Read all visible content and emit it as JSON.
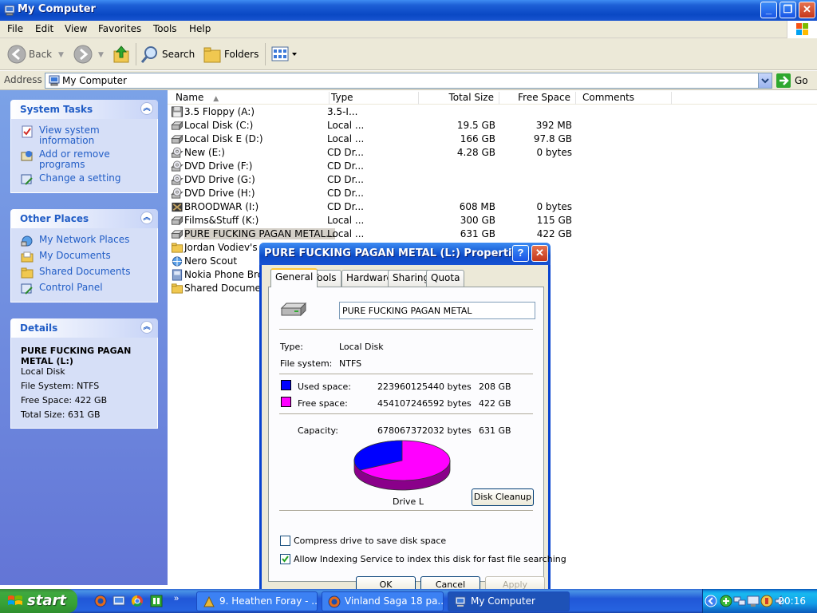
{
  "window": {
    "title": "My Computer",
    "controls": {
      "minimize": "_",
      "maximize": "❐",
      "close": "✕"
    }
  },
  "menu": [
    "File",
    "Edit",
    "View",
    "Favorites",
    "Tools",
    "Help"
  ],
  "toolbar": {
    "back": "Back",
    "search": "Search",
    "folders": "Folders"
  },
  "address": {
    "label": "Address",
    "value": "My Computer",
    "go": "Go"
  },
  "sidebar": {
    "system_tasks": {
      "title": "System Tasks",
      "items": [
        "View system information",
        "Add or remove programs",
        "Change a setting"
      ]
    },
    "other_places": {
      "title": "Other Places",
      "items": [
        "My Network Places",
        "My Documents",
        "Shared Documents",
        "Control Panel"
      ]
    },
    "details": {
      "title": "Details",
      "name": "PURE FUCKING PAGAN METAL (L:)",
      "type": "Local Disk",
      "file_system": "File System: NTFS",
      "free_space": "Free Space: 422 GB",
      "total_size": "Total Size: 631 GB"
    }
  },
  "columns": {
    "name": "Name",
    "type": "Type",
    "total": "Total Size",
    "free": "Free Space",
    "comments": "Comments"
  },
  "files": [
    {
      "name": "3.5 Floppy (A:)",
      "type": "3.5-I...",
      "total": "",
      "free": "",
      "icon": "floppy-icon"
    },
    {
      "name": "Local Disk (C:)",
      "type": "Local ...",
      "total": "19.5 GB",
      "free": "392 MB",
      "icon": "hard-disk-icon"
    },
    {
      "name": "Local Disk E (D:)",
      "type": "Local ...",
      "total": "166 GB",
      "free": "97.8 GB",
      "icon": "hard-disk-icon"
    },
    {
      "name": "New (E:)",
      "type": "CD Dr...",
      "total": "4.28 GB",
      "free": "0 bytes",
      "icon": "cd-drive-icon"
    },
    {
      "name": "DVD Drive (F:)",
      "type": "CD Dr...",
      "total": "",
      "free": "",
      "icon": "cd-drive-icon"
    },
    {
      "name": "DVD Drive (G:)",
      "type": "CD Dr...",
      "total": "",
      "free": "",
      "icon": "cd-drive-icon"
    },
    {
      "name": "DVD Drive (H:)",
      "type": "CD Dr...",
      "total": "",
      "free": "",
      "icon": "cd-drive-icon"
    },
    {
      "name": "BROODWAR (I:)",
      "type": "CD Dr...",
      "total": "608 MB",
      "free": "0 bytes",
      "icon": "game-disc-icon"
    },
    {
      "name": "Films&Stuff (K:)",
      "type": "Local ...",
      "total": "300 GB",
      "free": "115 GB",
      "icon": "hard-disk-icon"
    },
    {
      "name": "PURE FUCKING PAGAN METAL...",
      "type": "Local ...",
      "total": "631 GB",
      "free": "422 GB",
      "icon": "hard-disk-icon",
      "selected": true
    },
    {
      "name": "Jordan Vodiev's",
      "type": "",
      "total": "",
      "free": "",
      "icon": "folder-icon"
    },
    {
      "name": "Nero Scout",
      "type": "",
      "total": "",
      "free": "",
      "icon": "network-globe-icon"
    },
    {
      "name": "Nokia Phone Brow",
      "type": "",
      "total": "",
      "free": "",
      "icon": "phone-browser-icon"
    },
    {
      "name": "Shared Documen",
      "type": "",
      "total": "",
      "free": "",
      "icon": "folder-icon"
    }
  ],
  "dialog": {
    "title": "PURE FUCKING PAGAN METAL (L:) Properties",
    "tabs": [
      "General",
      "Tools",
      "Hardware",
      "Sharing",
      "Quota"
    ],
    "label_value": "PURE FUCKING PAGAN METAL",
    "type_label": "Type:",
    "type_value": "Local Disk",
    "fs_label": "File system:",
    "fs_value": "NTFS",
    "used_label": "Used space:",
    "used_bytes": "223960125440 bytes",
    "used_gb": "208 GB",
    "free_label": "Free space:",
    "free_bytes": "454107246592 bytes",
    "free_gb": "422 GB",
    "capacity_label": "Capacity:",
    "capacity_bytes": "678067372032 bytes",
    "capacity_gb": "631 GB",
    "drive_label": "Drive L",
    "used_fraction": 0.33,
    "used_color": "#0000ff",
    "free_color": "#ff00ff",
    "cleanup": "Disk Cleanup",
    "compress": "Compress drive to save disk space",
    "indexing": "Allow Indexing Service to index this disk for fast file searching",
    "compress_checked": false,
    "indexing_checked": true,
    "ok": "OK",
    "cancel": "Cancel",
    "apply": "Apply"
  },
  "taskbar": {
    "start": "start",
    "items": [
      "9. Heathen Foray - ...",
      "Vinland Saga 18 pa...",
      "My Computer"
    ],
    "time": "20:16"
  }
}
